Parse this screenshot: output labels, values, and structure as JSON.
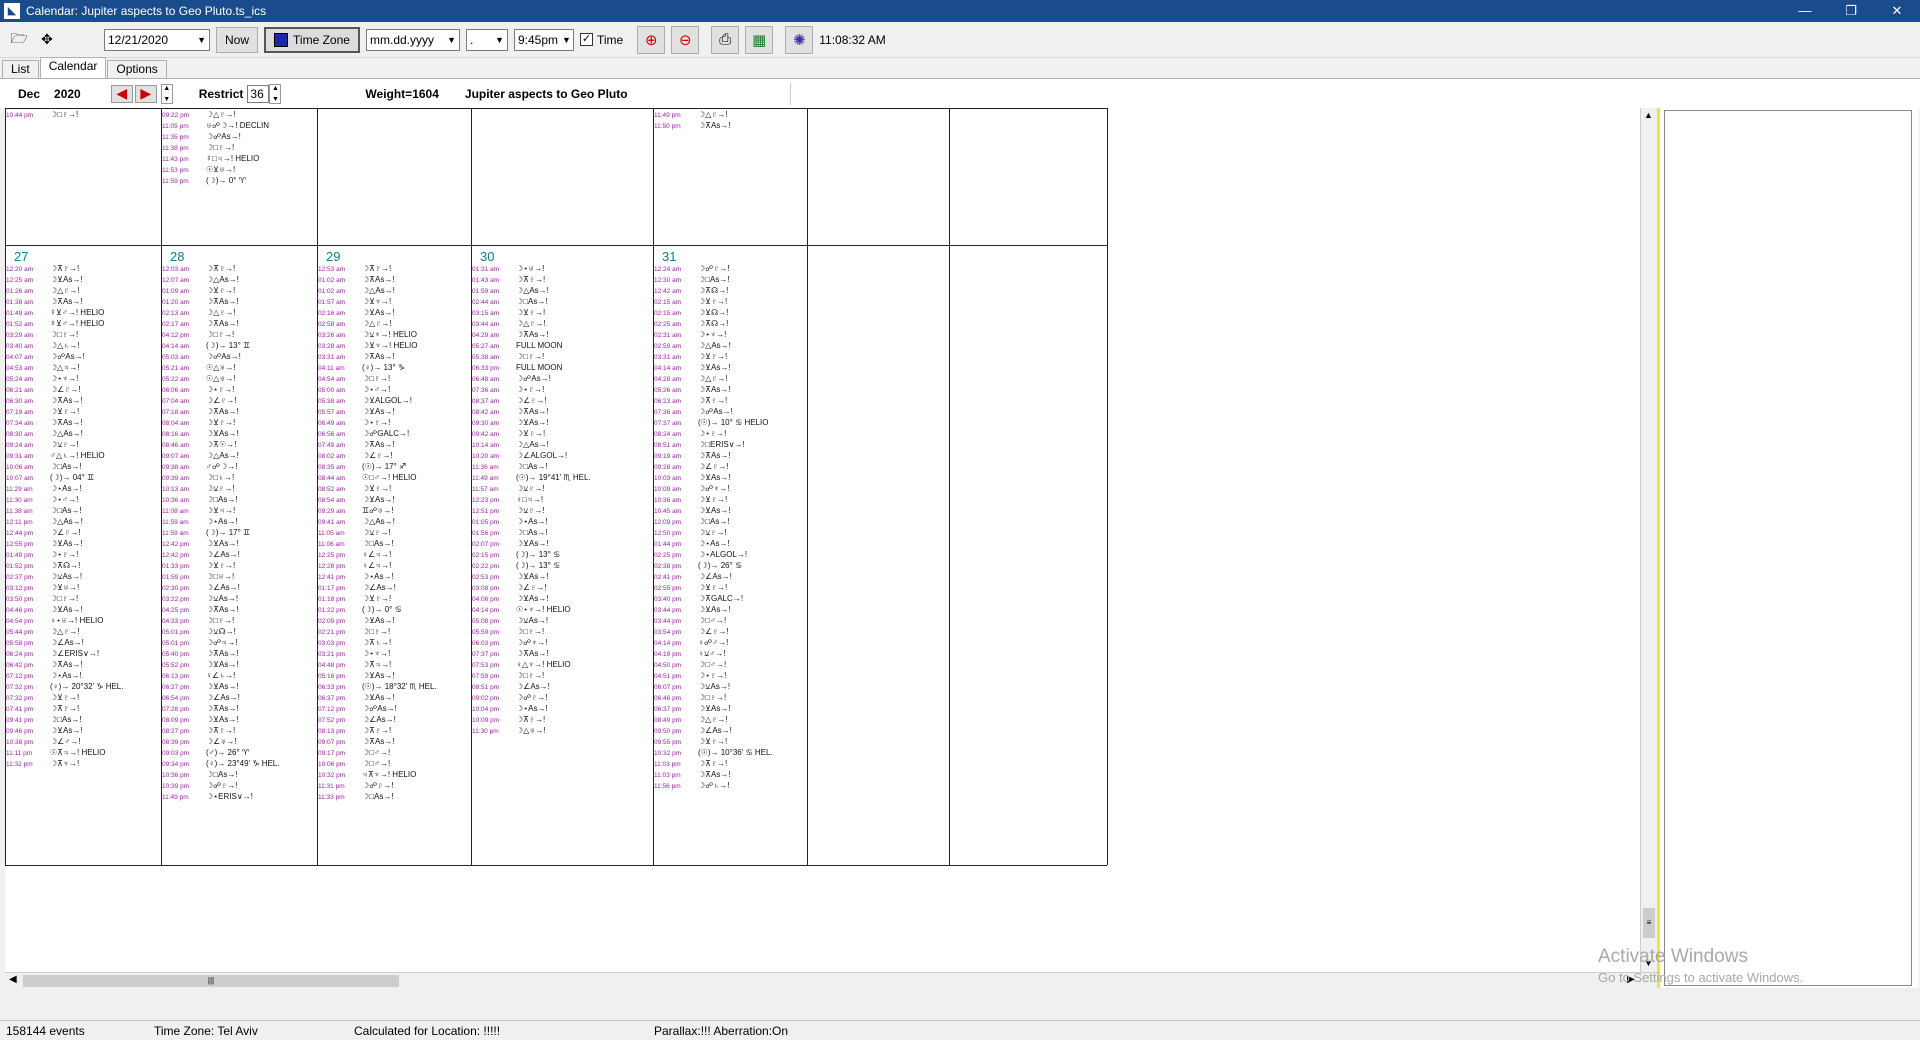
{
  "window": {
    "title": "Calendar: Jupiter aspects to Geo Pluto.ts_ics",
    "minimize": "—",
    "restore": "❐",
    "close": "✕"
  },
  "toolbar": {
    "date": "12/21/2020",
    "now_label": "Now",
    "timezone_label": "Time Zone",
    "date_format": "mm.dd.yyyy",
    "separator": ".",
    "time": "9:45pm",
    "time_checkbox_label": "Time",
    "clock": "11:08:32 AM"
  },
  "tabs": [
    "List",
    "Calendar",
    "Options"
  ],
  "calendar_header": {
    "month": "Dec",
    "year": "2020",
    "restrict_label": "Restrict",
    "restrict_value": "36",
    "weight": "Weight=1604",
    "title": "Jupiter aspects to Geo Pluto"
  },
  "week_prev": [
    {
      "col": 0,
      "events": [
        [
          "10:44 pm",
          "☽□♇→!"
        ]
      ]
    },
    {
      "col": 1,
      "events": [
        [
          "09:22 pm",
          "☽△♇→!"
        ],
        [
          "11:05 pm",
          "♅☍☽→! DECLIN"
        ],
        [
          "11:35 pm",
          "☽☍As→!"
        ],
        [
          "11:38 pm",
          "☽□♇→!"
        ],
        [
          "11:43 pm",
          "☿□♃→! HELIO"
        ],
        [
          "11:53 pm",
          "☉⊻♅→!"
        ],
        [
          "11:59 pm",
          "(☽)→ 0° ♈"
        ]
      ]
    },
    {
      "col": 2,
      "events": []
    },
    {
      "col": 3,
      "events": []
    },
    {
      "col": 4,
      "events": [
        [
          "11:49 pm",
          "☽△♇→!"
        ],
        [
          "11:50 pm",
          "☽⊼As→!"
        ]
      ]
    },
    {
      "col": 5,
      "events": []
    },
    {
      "col": 6,
      "events": []
    }
  ],
  "week_last": [
    {
      "col": 0,
      "day": "27",
      "events": [
        [
          "12:20 am",
          "☽⊼♇→!"
        ],
        [
          "12:25 am",
          "☽⊻As→!"
        ],
        [
          "01:26 am",
          "☽△♇→!"
        ],
        [
          "01:38 am",
          "☽⊼As→!"
        ],
        [
          "01:49 am",
          "☿⊻♂→! HELIO"
        ],
        [
          "01:52 am",
          "☿⊻♂→! HELIO"
        ],
        [
          "03:29 am",
          "☽□♇→!"
        ],
        [
          "03:40 am",
          "☽△♄→!"
        ],
        [
          "04:07 am",
          "☽☍As→!"
        ],
        [
          "04:53 am",
          "☽△♃→!"
        ],
        [
          "05:24 am",
          "☽⋆♆→!"
        ],
        [
          "06:21 am",
          "☽∠♇→!"
        ],
        [
          "06:30 am",
          "☽⊼As→!"
        ],
        [
          "07:19 am",
          "☽⊻♇→!"
        ],
        [
          "07:34 am",
          "☽⊼As→!"
        ],
        [
          "08:30 am",
          "☽△As→!"
        ],
        [
          "09:24 am",
          "☽⚺♇→!"
        ],
        [
          "09:31 am",
          "♂△♄→! HELIO"
        ],
        [
          "10:06 am",
          "☽□As→!"
        ],
        [
          "10:07 am",
          "(☽)→ 04° ♊"
        ],
        [
          "11:29 am",
          "☽⋆As→!"
        ],
        [
          "11:30 am",
          "☽⋆♂→!"
        ],
        [
          "11:38 am",
          "☽□As→!"
        ],
        [
          "12:11 pm",
          "☽△As→!"
        ],
        [
          "12:44 pm",
          "☽∠♇→!"
        ],
        [
          "12:55 pm",
          "☽⊻As→!"
        ],
        [
          "01:49 pm",
          "☽⋆♇→!"
        ],
        [
          "01:52 pm",
          "☽⊼☊→!"
        ],
        [
          "02:37 pm",
          "☽⚺As→!"
        ],
        [
          "03:12 pm",
          "☽⊻♅→!"
        ],
        [
          "03:50 pm",
          "☽□♇→!"
        ],
        [
          "04:46 pm",
          "☽⊻As→!"
        ],
        [
          "04:54 pm",
          "♀⋆♅→! HELIO"
        ],
        [
          "05:44 pm",
          "☽△♇→!"
        ],
        [
          "05:58 pm",
          "☽∠As→!"
        ],
        [
          "06:24 pm",
          "☽∠ERIS∨→!"
        ],
        [
          "06:42 pm",
          "☽⊼As→!"
        ],
        [
          "07:12 pm",
          "☽⋆As→!"
        ],
        [
          "07:32 pm",
          "(♀)→ 20°32' ♑ HEL."
        ],
        [
          "07:32 pm",
          "☽⊻♇→!"
        ],
        [
          "07:41 pm",
          "☽⊼♇→!"
        ],
        [
          "09:41 pm",
          "☽□As→!"
        ],
        [
          "09:46 pm",
          "☽⊻As→!"
        ],
        [
          "10:38 pm",
          "☽∠♂→!"
        ],
        [
          "11:11 pm",
          "☉⊼♃→! HELIO"
        ],
        [
          "11:32 pm",
          "☽⊼♆→!"
        ]
      ]
    },
    {
      "col": 1,
      "day": "28",
      "events": [
        [
          "12:03 am",
          "☽⊼♇→!"
        ],
        [
          "12:07 am",
          "☽△As→!"
        ],
        [
          "01:09 am",
          "☽⊻♇→!"
        ],
        [
          "01:20 am",
          "☽⊼As→!"
        ],
        [
          "02:13 am",
          "☽△♇→!"
        ],
        [
          "02:17 am",
          "☽⊼As→!"
        ],
        [
          "04:12 pm",
          "☽□♇→!"
        ],
        [
          "04:14 am",
          "(☽)→ 13° ♊"
        ],
        [
          "05:03 am",
          "☽☍As→!"
        ],
        [
          "05:21 am",
          "☉△♅→!"
        ],
        [
          "05:22 am",
          "☉△♅→!"
        ],
        [
          "06:06 am",
          "☽⋆♇→!"
        ],
        [
          "07:04 am",
          "☽∠♇→!"
        ],
        [
          "07:18 am",
          "☽⊼As→!"
        ],
        [
          "08:04 am",
          "☽⊻♇→!"
        ],
        [
          "08:16 am",
          "☽⊻As→!"
        ],
        [
          "08:46 am",
          "☽⊼☉→!"
        ],
        [
          "09:07 am",
          "☽△As→!"
        ],
        [
          "09:38 am",
          "♂☍☽→!"
        ],
        [
          "09:39 am",
          "☽□♄→!"
        ],
        [
          "10:13 am",
          "☽⚺♇→!"
        ],
        [
          "10:36 am",
          "☽□As→!"
        ],
        [
          "11:08 am",
          "☽⊻♃→!"
        ],
        [
          "11:59 am",
          "☽⋆As→!"
        ],
        [
          "11:59 am",
          "(☽)→ 17° ♊"
        ],
        [
          "12:42 pm",
          "☽⊻As→!"
        ],
        [
          "12:42 pm",
          "☽∠As→!"
        ],
        [
          "01:33 pm",
          "☽⊻♇→!"
        ],
        [
          "01:59 pm",
          "☽□♅→!"
        ],
        [
          "02:30 pm",
          "☽∠As→!"
        ],
        [
          "03:22 pm",
          "☽⚺As→!"
        ],
        [
          "04:25 pm",
          "☽⊼As→!"
        ],
        [
          "04:33 pm",
          "☽□♇→!"
        ],
        [
          "05:01 pm",
          "☽⚺☊→!"
        ],
        [
          "05:01 pm",
          "☽☍♃→!"
        ],
        [
          "05:40 pm",
          "☽⊼As→!"
        ],
        [
          "05:52 pm",
          "☽⊻As→!"
        ],
        [
          "06:13 pm",
          "♀∠♄→!"
        ],
        [
          "06:27 pm",
          "☽⊻As→!"
        ],
        [
          "06:54 pm",
          "☽∠As→!"
        ],
        [
          "07:28 pm",
          "☽⊼As→!"
        ],
        [
          "08:09 pm",
          "☽⊻As→!"
        ],
        [
          "08:27 pm",
          "☽⊼♇→!"
        ],
        [
          "08:39 pm",
          "☽∠♅→!"
        ],
        [
          "09:03 pm",
          "(♂)→ 26° ♈"
        ],
        [
          "09:34 pm",
          "(♀)→ 23°49' ♑ HEL."
        ],
        [
          "10:36 pm",
          "☽□As→!"
        ],
        [
          "10:39 pm",
          "☽☍♇→!"
        ],
        [
          "11:49 pm",
          "☽⋆ERIS∨→!"
        ]
      ]
    },
    {
      "col": 2,
      "day": "29",
      "events": [
        [
          "12:53 am",
          "☽⊼♇→!"
        ],
        [
          "01:02 am",
          "☽⊼As→!"
        ],
        [
          "01:02 am",
          "☽△As→!"
        ],
        [
          "01:57 am",
          "☽⊻♆→!"
        ],
        [
          "02:16 am",
          "☽⊻As→!"
        ],
        [
          "02:58 am",
          "☽△♇→!"
        ],
        [
          "03:26 am",
          "☽⚺♆→! HELIO"
        ],
        [
          "03:28 am",
          "☽⊻♆→! HELIO"
        ],
        [
          "03:31 am",
          "☽⊼As→!"
        ],
        [
          "04:11 am",
          "(♀)→ 13° ♑"
        ],
        [
          "04:54 am",
          "☽□♇→!"
        ],
        [
          "05:00 am",
          "☽⋆♂→!"
        ],
        [
          "05:38 am",
          "☽⊻ALGOL→!"
        ],
        [
          "05:57 am",
          "☽⊻As→!"
        ],
        [
          "06:49 am",
          "☽⋆♇→!"
        ],
        [
          "06:56 am",
          "☽☍GALC→!"
        ],
        [
          "07:49 am",
          "☽⊼As→!"
        ],
        [
          "08:02 am",
          "☽∠♇→!"
        ],
        [
          "08:35 am",
          "(☉)→ 17° ♐"
        ],
        [
          "08:44 am",
          "☉□♂→! HELIO"
        ],
        [
          "08:52 am",
          "☽⊻♇→!"
        ],
        [
          "08:54 am",
          "☽⊻As→!"
        ],
        [
          "09:29 am",
          "♊☍♅→!"
        ],
        [
          "09:41 am",
          "☽△As→!"
        ],
        [
          "11:05 am",
          "☽⚺♇→!"
        ],
        [
          "11:06 am",
          "☽□As→!"
        ],
        [
          "12:25 pm",
          "♀∠♃→!"
        ],
        [
          "12:28 pm",
          "♀∠♃→!"
        ],
        [
          "12:41 pm",
          "☽⋆As→!"
        ],
        [
          "01:17 pm",
          "☽∠As→!"
        ],
        [
          "01:18 pm",
          "☽⊻♇→!"
        ],
        [
          "01:22 pm",
          "(☽)→ 0° ♋"
        ],
        [
          "02:09 pm",
          "☽⊻As→!"
        ],
        [
          "02:21 pm",
          "☽□♇→!"
        ],
        [
          "03:03 pm",
          "☽⊼♄→!"
        ],
        [
          "03:21 pm",
          "☽⋆♆→!"
        ],
        [
          "04:48 pm",
          "☽⊼♃→!"
        ],
        [
          "05:16 pm",
          "☽⊻As→!"
        ],
        [
          "06:33 pm",
          "(☉)→ 18°32' ♏ HEL."
        ],
        [
          "06:37 pm",
          "☽⊻As→!"
        ],
        [
          "07:12 pm",
          "☽☍As→!"
        ],
        [
          "07:52 pm",
          "☽∠As→!"
        ],
        [
          "08:13 pm",
          "☽⊼♇→!"
        ],
        [
          "09:07 pm",
          "☽⊼As→!"
        ],
        [
          "09:17 pm",
          "☽□♂→!"
        ],
        [
          "10:06 pm",
          "☽□♂→!"
        ],
        [
          "10:32 pm",
          "♃⊼♆→! HELIO"
        ],
        [
          "11:31 pm",
          "☽☍♇→!"
        ],
        [
          "11:33 pm",
          "☽□As→!"
        ]
      ]
    },
    {
      "col": 3,
      "day": "30",
      "events": [
        [
          "01:31 am",
          "☽⋆♅→!"
        ],
        [
          "01:43 am",
          "☽⊼♇→!"
        ],
        [
          "01:59 am",
          "☽△As→!"
        ],
        [
          "02:44 am",
          "☽□As→!"
        ],
        [
          "03:15 am",
          "☽⊻♇→!"
        ],
        [
          "03:44 am",
          "☽△♇→!"
        ],
        [
          "04:29 am",
          "☽⊼As→!"
        ],
        [
          "05:27 am",
          "FULL MOON"
        ],
        [
          "05:38 am",
          "☽□♇→!"
        ],
        [
          "06:33 pm",
          "FULL MOON"
        ],
        [
          "06:48 am",
          "☽☍As→!"
        ],
        [
          "07:36 am",
          "☽⋆♇→!"
        ],
        [
          "08:37 am",
          "☽∠♇→!"
        ],
        [
          "08:42 am",
          "☽⊼As→!"
        ],
        [
          "09:30 am",
          "☽⊻As→!"
        ],
        [
          "09:42 am",
          "☽⊻♇→!"
        ],
        [
          "10:14 am",
          "☽△As→!"
        ],
        [
          "10:20 am",
          "☽∠ALGOL→!"
        ],
        [
          "11:36 am",
          "☽□As→!"
        ],
        [
          "11:49 am",
          "(☉)→ 19°41' ♏ HEL."
        ],
        [
          "11:57 am",
          "☽⚺♇→!"
        ],
        [
          "12:23 pm",
          "♀□♃→!"
        ],
        [
          "12:51 pm",
          "☽⚺♇→!"
        ],
        [
          "01:05 pm",
          "☽⋆As→!"
        ],
        [
          "01:56 pm",
          "☽□As→!"
        ],
        [
          "02:07 pm",
          "☽⊻As→!"
        ],
        [
          "02:15 pm",
          "(☽)→ 13° ♋"
        ],
        [
          "02:22 pm",
          "(☽)→ 13° ♋"
        ],
        [
          "02:53 pm",
          "☽⊻As→!"
        ],
        [
          "03:08 pm",
          "☽∠♇→!"
        ],
        [
          "04:06 pm",
          "☽⊻As→!"
        ],
        [
          "04:14 pm",
          "☉⋆♆→! HELIO"
        ],
        [
          "05:08 pm",
          "☽⚺As→!"
        ],
        [
          "05:59 pm",
          "☽□♇→!"
        ],
        [
          "06:03 pm",
          "☽☍♆→!"
        ],
        [
          "07:37 pm",
          "☽⊼As→!"
        ],
        [
          "07:53 pm",
          "♀△♆→! HELIO"
        ],
        [
          "07:59 pm",
          "☽□♇→!"
        ],
        [
          "08:51 pm",
          "☽∠As→!"
        ],
        [
          "09:02 pm",
          "☽☍♇→!"
        ],
        [
          "10:04 pm",
          "☽⋆As→!"
        ],
        [
          "10:09 pm",
          "☽⊼♇→!"
        ],
        [
          "11:30 pm",
          "☽△♅→!"
        ]
      ]
    },
    {
      "col": 4,
      "day": "31",
      "events": [
        [
          "12:24 am",
          "☽☍♇→!"
        ],
        [
          "12:30 am",
          "☽□As→!"
        ],
        [
          "12:42 am",
          "☽⊼☊→!"
        ],
        [
          "02:15 am",
          "☽⊻♇→!"
        ],
        [
          "02:15 am",
          "☽⊻☊→!"
        ],
        [
          "02:25 am",
          "☽⊼☊→!"
        ],
        [
          "02:31 am",
          "☽⋆♆→!"
        ],
        [
          "02:59 am",
          "☽△As→!"
        ],
        [
          "03:31 am",
          "☽⊻♇→!"
        ],
        [
          "04:14 am",
          "☽⊻As→!"
        ],
        [
          "04:28 am",
          "☽△♇→!"
        ],
        [
          "05:26 am",
          "☽⊼As→!"
        ],
        [
          "06:23 am",
          "☽⊼♇→!"
        ],
        [
          "07:36 am",
          "☽☍As→!"
        ],
        [
          "07:37 am",
          "(☉)→ 10° ♋ HELIO"
        ],
        [
          "08:24 am",
          "☽⋆♇→!"
        ],
        [
          "08:51 am",
          "☽□ERIS∨→!"
        ],
        [
          "09:19 am",
          "☽⊼As→!"
        ],
        [
          "09:28 am",
          "☽∠♇→!"
        ],
        [
          "10:03 am",
          "☽⊻As→!"
        ],
        [
          "10:09 am",
          "☽☍♆→!"
        ],
        [
          "10:36 am",
          "☽⊻♇→!"
        ],
        [
          "10:45 am",
          "☽⊻As→!"
        ],
        [
          "12:09 pm",
          "☽□As→!"
        ],
        [
          "12:50 pm",
          "☽⚺♇→!"
        ],
        [
          "01:44 pm",
          "☽⋆As→!"
        ],
        [
          "02:25 pm",
          "☽⋆ALGOL→!"
        ],
        [
          "02:38 pm",
          "(☽)→ 26° ♋"
        ],
        [
          "02:41 pm",
          "☽∠As→!"
        ],
        [
          "02:55 pm",
          "☽⊻♇→!"
        ],
        [
          "03:40 pm",
          "☽⊼GALC→!"
        ],
        [
          "03:44 pm",
          "☽⊻As→!"
        ],
        [
          "03:44 pm",
          "☽□♂→!"
        ],
        [
          "03:54 pm",
          "☽∠♇→!"
        ],
        [
          "04:14 pm",
          "♀☍♂→!"
        ],
        [
          "04:19 pm",
          "♀⚺♂→!"
        ],
        [
          "04:50 pm",
          "☽□♂→!"
        ],
        [
          "04:51 pm",
          "☽⋆♇→!"
        ],
        [
          "06:07 pm",
          "☽⚺As→!"
        ],
        [
          "06:46 pm",
          "☽□♇→!"
        ],
        [
          "06:37 pm",
          "☽⊻As→!"
        ],
        [
          "08:49 pm",
          "☽△♇→!"
        ],
        [
          "09:50 pm",
          "☽∠As→!"
        ],
        [
          "09:55 pm",
          "☽⊻♇→!"
        ],
        [
          "10:32 pm",
          "(☉)→ 10°36' ♋ HEL."
        ],
        [
          "11:03 pm",
          "☽⊼♇→!"
        ],
        [
          "11:03 pm",
          "☽⊼As→!"
        ],
        [
          "11:56 pm",
          "☽☍♄→!"
        ]
      ]
    },
    {
      "col": 5,
      "day": "",
      "events": []
    },
    {
      "col": 6,
      "day": "",
      "events": []
    }
  ],
  "watermark": {
    "line1": "Activate Windows",
    "line2": "Go to Settings to activate Windows."
  },
  "status": {
    "events": "158144 events",
    "timezone": "Time Zone: Tel Aviv",
    "location": "Calculated for Location: !!!!!",
    "parallax": "Parallax:!!!  Aberration:On"
  },
  "colors": {
    "titlebar": "#1a4b8c",
    "day_number": "#0a7f8f",
    "event_time": "#9b1fa0"
  },
  "icons": [
    "open-folder-icon",
    "move-icon",
    "zoom-in-icon",
    "zoom-out-icon",
    "print-icon",
    "excel-icon",
    "settings-icon",
    "prev-arrow-icon",
    "next-arrow-icon"
  ]
}
